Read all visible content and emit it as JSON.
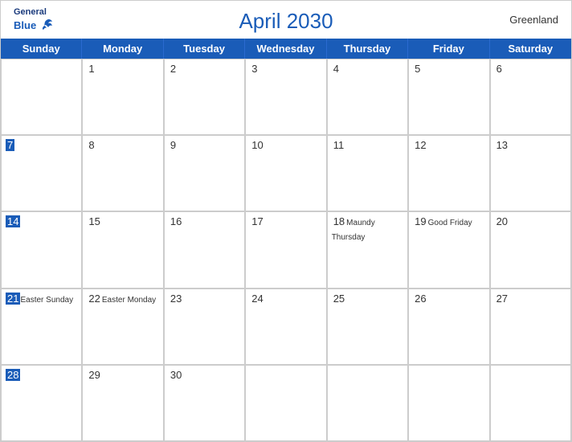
{
  "header": {
    "title": "April 2030",
    "country": "Greenland",
    "logo": {
      "line1": "General",
      "line2": "Blue"
    }
  },
  "dayHeaders": [
    "Sunday",
    "Monday",
    "Tuesday",
    "Wednesday",
    "Thursday",
    "Friday",
    "Saturday"
  ],
  "weeks": [
    [
      {
        "date": "",
        "event": ""
      },
      {
        "date": "1",
        "event": ""
      },
      {
        "date": "2",
        "event": ""
      },
      {
        "date": "3",
        "event": ""
      },
      {
        "date": "4",
        "event": ""
      },
      {
        "date": "5",
        "event": ""
      },
      {
        "date": "6",
        "event": ""
      }
    ],
    [
      {
        "date": "7",
        "event": ""
      },
      {
        "date": "8",
        "event": ""
      },
      {
        "date": "9",
        "event": ""
      },
      {
        "date": "10",
        "event": ""
      },
      {
        "date": "11",
        "event": ""
      },
      {
        "date": "12",
        "event": ""
      },
      {
        "date": "13",
        "event": ""
      }
    ],
    [
      {
        "date": "14",
        "event": ""
      },
      {
        "date": "15",
        "event": ""
      },
      {
        "date": "16",
        "event": ""
      },
      {
        "date": "17",
        "event": ""
      },
      {
        "date": "18",
        "event": "Maundy Thursday"
      },
      {
        "date": "19",
        "event": "Good Friday"
      },
      {
        "date": "20",
        "event": ""
      }
    ],
    [
      {
        "date": "21",
        "event": "Easter Sunday"
      },
      {
        "date": "22",
        "event": "Easter Monday"
      },
      {
        "date": "23",
        "event": ""
      },
      {
        "date": "24",
        "event": ""
      },
      {
        "date": "25",
        "event": ""
      },
      {
        "date": "26",
        "event": ""
      },
      {
        "date": "27",
        "event": ""
      }
    ],
    [
      {
        "date": "28",
        "event": ""
      },
      {
        "date": "29",
        "event": ""
      },
      {
        "date": "30",
        "event": ""
      },
      {
        "date": "",
        "event": ""
      },
      {
        "date": "",
        "event": ""
      },
      {
        "date": "",
        "event": ""
      },
      {
        "date": "",
        "event": ""
      }
    ]
  ]
}
